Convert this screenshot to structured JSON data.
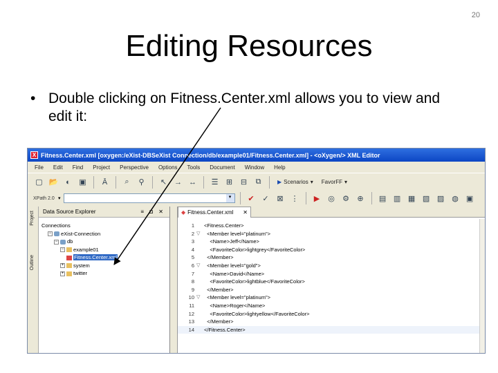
{
  "slide": {
    "number": "20",
    "title": "Editing Resources",
    "bullet_symbol": "•",
    "bullet_text": "Double clicking on Fitness.Center.xml allows you to view and edit it:"
  },
  "window": {
    "title": "Fitness.Center.xml [oxygen:/eXist-DBSeXist Connection/db/example01/Fitness.Center.xml] - <oXygen/> XML Editor",
    "app_icon": "X",
    "menu": [
      "File",
      "Edit",
      "Find",
      "Project",
      "Perspective",
      "Options",
      "Tools",
      "Document",
      "Window",
      "Help"
    ],
    "toolbar": {
      "icons": [
        "new-file-icon",
        "open-file-icon",
        "open-url-icon",
        "save-icon",
        "spellcheck-icon",
        "find-icon",
        "find-replace-icon",
        "back-icon",
        "forward-icon",
        "separator",
        "xslt-transform-icon",
        "validate-icon",
        "format-icon"
      ],
      "scenario_label": "Scenarios",
      "user_label": "FavorFF"
    },
    "xpath": {
      "select_label": "XPath 2.0"
    }
  },
  "left_panel": {
    "side_tabs": [
      "Project",
      "Outline"
    ],
    "title": "Data Source Explorer",
    "controls": "≡ ◘ ✕",
    "tree": [
      {
        "label": "Connections",
        "indent": 0,
        "expander": "",
        "icon": ""
      },
      {
        "label": "eXist-Connection",
        "indent": 1,
        "expander": "−",
        "icon": "db"
      },
      {
        "label": "db",
        "indent": 2,
        "expander": "−",
        "icon": "db"
      },
      {
        "label": "example01",
        "indent": 3,
        "expander": "−",
        "icon": "coll"
      },
      {
        "label": "Fitness.Center.xml",
        "indent": 4,
        "expander": "",
        "icon": "xml",
        "selected": true
      },
      {
        "label": "system",
        "indent": 3,
        "expander": "+",
        "icon": "coll"
      },
      {
        "label": "twitter",
        "indent": 3,
        "expander": "+",
        "icon": "coll"
      }
    ]
  },
  "editor": {
    "tab_label": "Fitness.Center.xml",
    "close": "✕",
    "lines": [
      {
        "n": "1",
        "fold": "",
        "text": "<Fitness.Center>"
      },
      {
        "n": "2",
        "fold": "▽",
        "text": "  <Member level=\"platinum\">"
      },
      {
        "n": "3",
        "fold": "",
        "text": "    <Name>Jeff</Name>"
      },
      {
        "n": "4",
        "fold": "",
        "text": "    <FavoriteColor>lightgrey</FavoriteColor>"
      },
      {
        "n": "5",
        "fold": "",
        "text": "  </Member>"
      },
      {
        "n": "6",
        "fold": "▽",
        "text": "  <Member level=\"gold\">"
      },
      {
        "n": "7",
        "fold": "",
        "text": "    <Name>David</Name>"
      },
      {
        "n": "8",
        "fold": "",
        "text": "    <FavoriteColor>lightblue</FavoriteColor>"
      },
      {
        "n": "9",
        "fold": "",
        "text": "  </Member>"
      },
      {
        "n": "10",
        "fold": "▽",
        "text": "  <Member level=\"platinum\">"
      },
      {
        "n": "11",
        "fold": "",
        "text": "    <Name>Roger</Name>"
      },
      {
        "n": "12",
        "fold": "",
        "text": "    <FavoriteColor>lightyellow</FavoriteColor>"
      },
      {
        "n": "13",
        "fold": "",
        "text": "  </Member>"
      },
      {
        "n": "14",
        "fold": "",
        "text": "</Fitness.Center>",
        "current": true
      }
    ]
  },
  "colors": {
    "titlebar": "#0c46c4",
    "selection": "#316ac5",
    "arrow": "#000000"
  }
}
